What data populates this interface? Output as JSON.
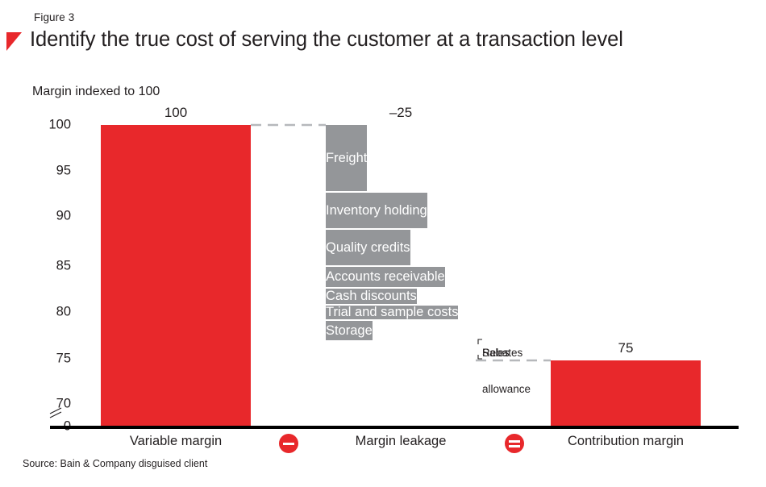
{
  "figure": {
    "label": "Figure 3",
    "title": "Identify the true cost of serving the customer at a transaction level",
    "accent_color": "#e8282b",
    "bar_color": "#e8282b",
    "segment_color": "#949699",
    "text_color": "#231f20"
  },
  "source": {
    "text": "Source: Bain & Company disguised client"
  },
  "chart_data": {
    "type": "bar",
    "title": "Identify the true cost of serving the customer at a transaction level",
    "subtitle": "Figure 3",
    "ylabel": "Margin indexed to 100",
    "xlabel": "",
    "ylim": [
      70,
      100
    ],
    "axis_break": true,
    "grid": false,
    "legend": "none",
    "yticks": [
      100,
      95,
      90,
      85,
      80,
      75,
      70,
      0
    ],
    "ytick_labels": [
      "100",
      "95",
      "90",
      "85",
      "80",
      "75",
      "70",
      "0"
    ],
    "categories": [
      "Variable margin",
      "Margin leakage",
      "Contribution margin"
    ],
    "values": [
      100,
      -25,
      75
    ],
    "value_labels": [
      "100",
      "–25",
      "75"
    ],
    "operators": [
      "minus",
      "equals"
    ],
    "operator_labels": [
      "−",
      "="
    ],
    "stacked_segments": [
      {
        "label": "Freight",
        "from": 100.0,
        "to": 92.0,
        "value": 8.0
      },
      {
        "label": "Inventory holding",
        "from": 92.0,
        "to": 87.3,
        "value": 4.7
      },
      {
        "label": "Quality credits",
        "from": 87.3,
        "to": 82.6,
        "value": 4.7
      },
      {
        "label": "Accounts receivable",
        "from": 82.6,
        "to": 79.9,
        "value": 2.7
      },
      {
        "label": "Cash discounts",
        "from": 79.9,
        "to": 77.8,
        "value": 2.1
      },
      {
        "label": "Trial and sample costs",
        "from": 77.8,
        "to": 76.0,
        "value": 1.8
      },
      {
        "label": "Storage",
        "from": 76.0,
        "to": 74.0,
        "value": 2.0
      },
      {
        "label": "Sales allowance",
        "from": 74.0,
        "to": 73.3,
        "value": 0.7,
        "callout": true
      },
      {
        "label": "Rebates",
        "from": 73.3,
        "to": 72.8,
        "value": 0.5,
        "callout": true
      }
    ],
    "callouts": [
      {
        "text": "Sales\nallowance"
      },
      {
        "text": "Rebates"
      }
    ],
    "connector_style": "dashed",
    "connector_color": "#b6b8bb"
  },
  "axis": {
    "tick_100": "100",
    "tick_95": "95",
    "tick_90": "90",
    "tick_85": "85",
    "tick_80": "80",
    "tick_75": "75",
    "tick_70": "70",
    "tick_0": "0",
    "y_title": "Margin indexed to 100"
  },
  "bars": {
    "b0_value": "100",
    "b1_value": "–25",
    "b2_value": "75",
    "c0": "Variable margin",
    "c1": "Margin leakage",
    "c2": "Contribution margin"
  },
  "segments": {
    "s0": "Freight",
    "s1": "Inventory holding",
    "s2": "Quality credits",
    "s3": "Accounts receivable",
    "s4": "Cash discounts",
    "s5": "Trial and sample costs",
    "s6": "Storage"
  },
  "callouts": {
    "sales_allowance_line1": "Sales",
    "sales_allowance_line2": "allowance",
    "rebates": "Rebates"
  }
}
